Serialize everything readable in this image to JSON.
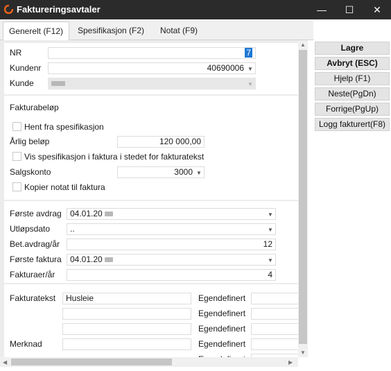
{
  "window": {
    "title": "Faktureringsavtaler",
    "minimize": "—",
    "maximize": "☐",
    "close": "✕",
    "accent": "#e8641b"
  },
  "tabs": [
    "Generelt (F12)",
    "Spesifikasjon (F2)",
    "Notat (F9)"
  ],
  "header": {
    "nr_label": "NR",
    "nr_value": "7",
    "kundenr_label": "Kundenr",
    "kundenr_value": "40690006",
    "kunde_label": "Kunde"
  },
  "invoice": {
    "heading": "Fakturabeløp",
    "fetch_label": "Hent fra spesifikasjon",
    "annual_label": "Årlig beløp",
    "annual_value": "120 000,00",
    "show_spec_label": "Vis spesifikasjon i faktura i stedet for fakturatekst",
    "account_label": "Salgskonto",
    "account_value": "3000",
    "copy_note_label": "Kopier notat til faktura"
  },
  "schedule": {
    "first_installment_label": "Første avdrag",
    "first_installment_value": "04.01.20",
    "expiry_label": "Utløpsdato",
    "expiry_value": "..",
    "payments_label": "Bet.avdrag/år",
    "payments_value": "12",
    "first_invoice_label": "Første faktura",
    "first_invoice_value": "04.01.20",
    "invoices_label": "Fakturaer/år",
    "invoices_value": "4"
  },
  "text": {
    "invoice_text_label": "Fakturatekst",
    "invoice_text_value": "Husleie",
    "note_label": "Merknad",
    "custom_label": "Egendefinert"
  },
  "buttons": {
    "save": "Lagre",
    "cancel": "Avbryt (ESC)",
    "help": "Hjelp (F1)",
    "next": "Neste(PgDn)",
    "prev": "Forrige(PgUp)",
    "log": "Logg fakturert(F8)"
  }
}
